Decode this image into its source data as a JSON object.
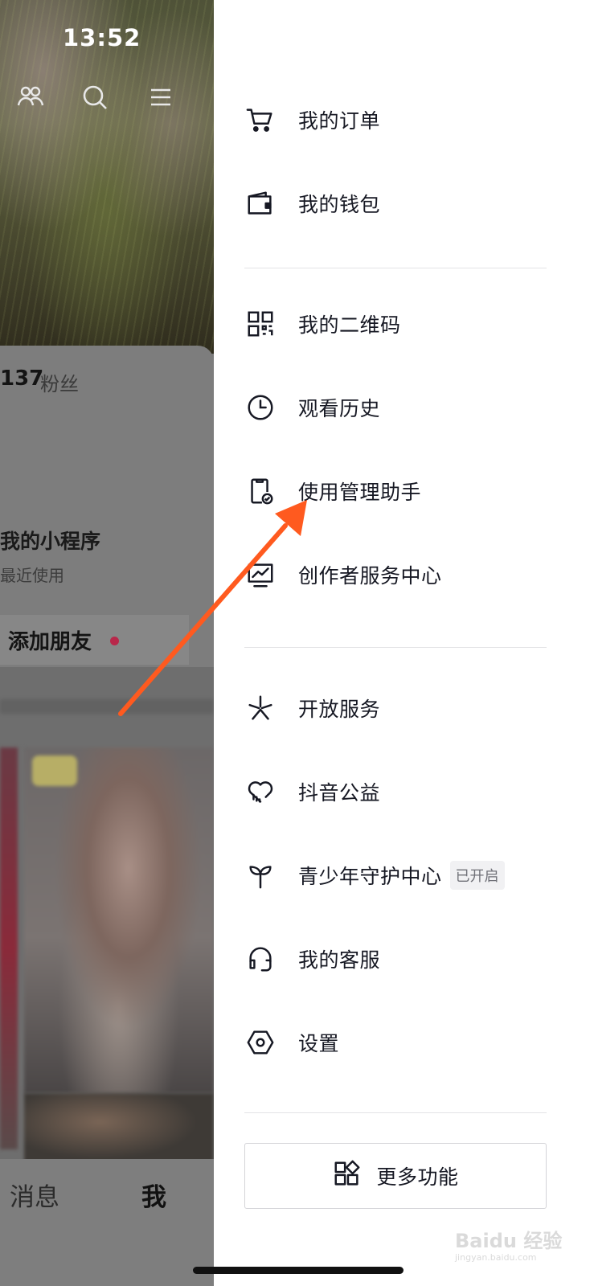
{
  "status_bar": {
    "time": "13:52"
  },
  "background": {
    "header_icons": [
      "friends-icon",
      "search-icon",
      "menu-icon"
    ],
    "fans": {
      "count": "137",
      "label": "粉丝"
    },
    "mini_programs": {
      "title": "我的小程序",
      "subtitle": "最近使用"
    },
    "add_friend": {
      "label": "添加朋友"
    },
    "tabbar": {
      "messages": "消息",
      "me": "我"
    }
  },
  "drawer": {
    "menu_group_1": [
      {
        "label": "我的订单",
        "icon": "cart-icon"
      },
      {
        "label": "我的钱包",
        "icon": "wallet-icon"
      }
    ],
    "menu_group_2": [
      {
        "label": "我的二维码",
        "icon": "qr-code-icon"
      },
      {
        "label": "观看历史",
        "icon": "clock-icon"
      },
      {
        "label": "使用管理助手",
        "icon": "phone-check-icon"
      },
      {
        "label": "创作者服务中心",
        "icon": "creator-chart-icon"
      }
    ],
    "menu_group_3": [
      {
        "label": "开放服务",
        "icon": "open-services-icon"
      },
      {
        "label": "抖音公益",
        "icon": "charity-heart-icon"
      },
      {
        "label": "青少年守护中心",
        "icon": "sprout-icon",
        "badge": "已开启"
      },
      {
        "label": "我的客服",
        "icon": "headset-icon"
      },
      {
        "label": "设置",
        "icon": "settings-hex-icon"
      }
    ],
    "more_button": {
      "label": "更多功能",
      "icon": "apps-grid-icon"
    }
  },
  "watermark": {
    "text": "Baidu 经验",
    "sub": "jingyan.baidu.com"
  },
  "colors": {
    "annotation_arrow": "#ff5a1f",
    "badge_bg": "#f1f1f3",
    "divider": "#e3e3e6"
  }
}
